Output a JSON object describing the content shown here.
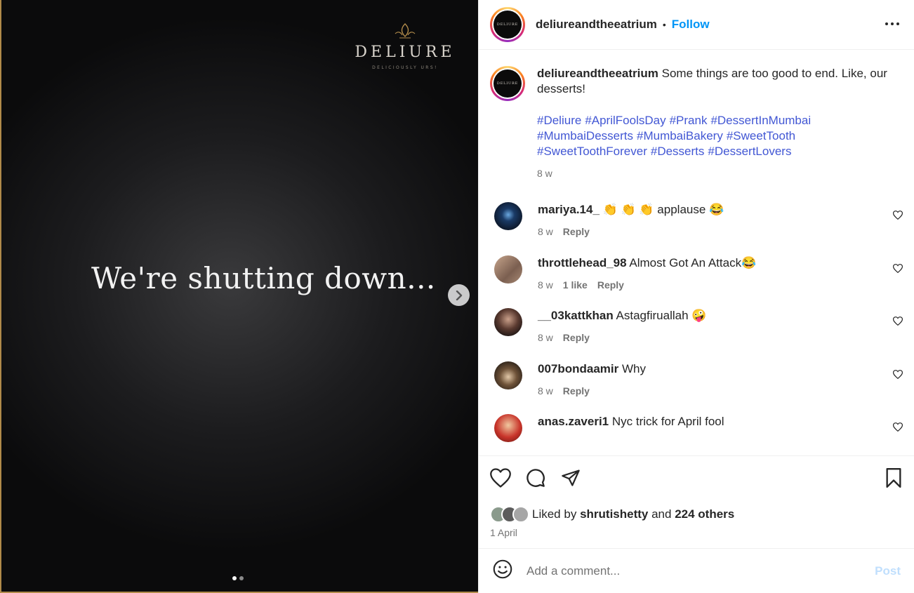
{
  "media": {
    "brand_name": "DELIURE",
    "brand_tagline": "DELICIOUSLY URS!",
    "headline": "We're shutting down...",
    "slides": 2,
    "active_slide": 1,
    "next_icon": "chevron-right-icon"
  },
  "header": {
    "username": "deliureandtheeatrium",
    "separator": "•",
    "follow_label": "Follow",
    "more_icon": "more-horizontal-icon",
    "avatar_text": "DELIURE"
  },
  "caption": {
    "username": "deliureandtheeatrium",
    "text": "Some things are too good to end. Like, our desserts!",
    "hashtags": [
      "#Deliure",
      "#AprilFoolsDay",
      "#Prank",
      "#DessertInMumbai",
      "#MumbaiDesserts",
      "#MumbaiBakery",
      "#SweetTooth",
      "#SweetToothForever",
      "#Desserts",
      "#DessertLovers"
    ],
    "time": "8 w"
  },
  "comments": [
    {
      "username": "mariya.14_",
      "text": "👏 👏 👏 applause 😂",
      "time": "8 w",
      "likes": "",
      "reply": "Reply",
      "avatar_color": "#0e1a2e"
    },
    {
      "username": "throttlehead_98",
      "text": "Almost Got An Attack😂",
      "time": "8 w",
      "likes": "1 like",
      "reply": "Reply",
      "avatar_color": "#9a7d6a"
    },
    {
      "username": "__03kattkhan",
      "text": "Astagfiruallah 🤪",
      "time": "8 w",
      "likes": "",
      "reply": "Reply",
      "avatar_color": "#3a2f2c"
    },
    {
      "username": "007bondaamir",
      "text": "Why",
      "time": "8 w",
      "likes": "",
      "reply": "Reply",
      "avatar_color": "#4b3a28"
    },
    {
      "username": "anas.zaveri1",
      "text": "Nyc trick for April fool",
      "time": "",
      "likes": "",
      "reply": "",
      "avatar_color": "#c8342a"
    }
  ],
  "actions": {
    "like_icon": "heart-icon",
    "comment_icon": "comment-icon",
    "share_icon": "share-icon",
    "save_icon": "bookmark-icon"
  },
  "likes": {
    "prefix": "Liked by",
    "user": "shrutishetty",
    "conj": "and",
    "others": "224 others",
    "avatar_colors": [
      "#8a9a8c",
      "#5c5c5c",
      "#a6a6a6"
    ]
  },
  "post_date": "1 April",
  "add_comment": {
    "emoji_icon": "emoji-icon",
    "placeholder": "Add a comment...",
    "post_label": "Post"
  },
  "colors": {
    "link": "#0095f6",
    "hashtag": "#4257d4",
    "muted": "#737373",
    "gold_border": "#b08a4a"
  }
}
